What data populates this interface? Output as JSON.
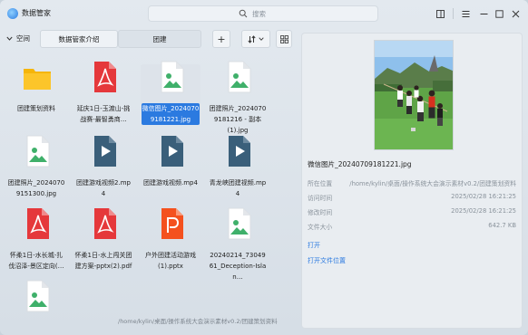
{
  "window": {
    "title": "数据管家"
  },
  "search": {
    "placeholder": "搜索"
  },
  "toolbar": {
    "space_label": "空间",
    "tabs": [
      {
        "label": "数据管家介绍"
      },
      {
        "label": "团建"
      }
    ],
    "add_label": "+"
  },
  "files": [
    {
      "name": "团建策划资料",
      "type": "folder"
    },
    {
      "name": "延庆1日-玉渡山-挑战赛-最智勇商…",
      "type": "pdf"
    },
    {
      "name": "微信图片_20240709181221.jpg",
      "type": "image",
      "selected": true
    },
    {
      "name": "团建照片_20240709181216 - 副本(1).jpg",
      "type": "image"
    },
    {
      "name": "团建照片_20240709151300.jpg",
      "type": "image"
    },
    {
      "name": "团建游戏视频2.mp4",
      "type": "video"
    },
    {
      "name": "团建游戏视频.mp4",
      "type": "video"
    },
    {
      "name": "青龙峡团建视频.mp4",
      "type": "video"
    },
    {
      "name": "怀柔1日-水长城-扎伐沼泽-景区定向(…",
      "type": "pdf"
    },
    {
      "name": "怀柔1日-水上闯关团建方案-pptx(2).pdf",
      "type": "pdf"
    },
    {
      "name": "户外团建活动游戏(1).pptx",
      "type": "pptx"
    },
    {
      "name": "20240214_7304961_Deception-Islan…",
      "type": "image"
    },
    {
      "name": "",
      "type": "image"
    }
  ],
  "path_bar": "/home/kylin/桌面/操作系统大会演示素材v0.2/团建策划资料",
  "preview": {
    "file_name": "微信图片_20240709181221.jpg",
    "meta": [
      {
        "key": "所在位置",
        "value": "/home/kylin/桌面/操作系统大会演示素材v0.2/团建策划资料"
      },
      {
        "key": "访问时间",
        "value": "2025/02/28 16:21:25"
      },
      {
        "key": "修改时间",
        "value": "2025/02/28 16:21:25"
      },
      {
        "key": "文件大小",
        "value": "642.7 KB"
      }
    ],
    "open_label": "打开",
    "open_location_label": "打开文件位置"
  },
  "colors": {
    "accent": "#2b7ae0",
    "pdf": "#e5383b",
    "pptx": "#f4511e",
    "video": "#3a5f7a",
    "folder": "#f5b50a"
  }
}
